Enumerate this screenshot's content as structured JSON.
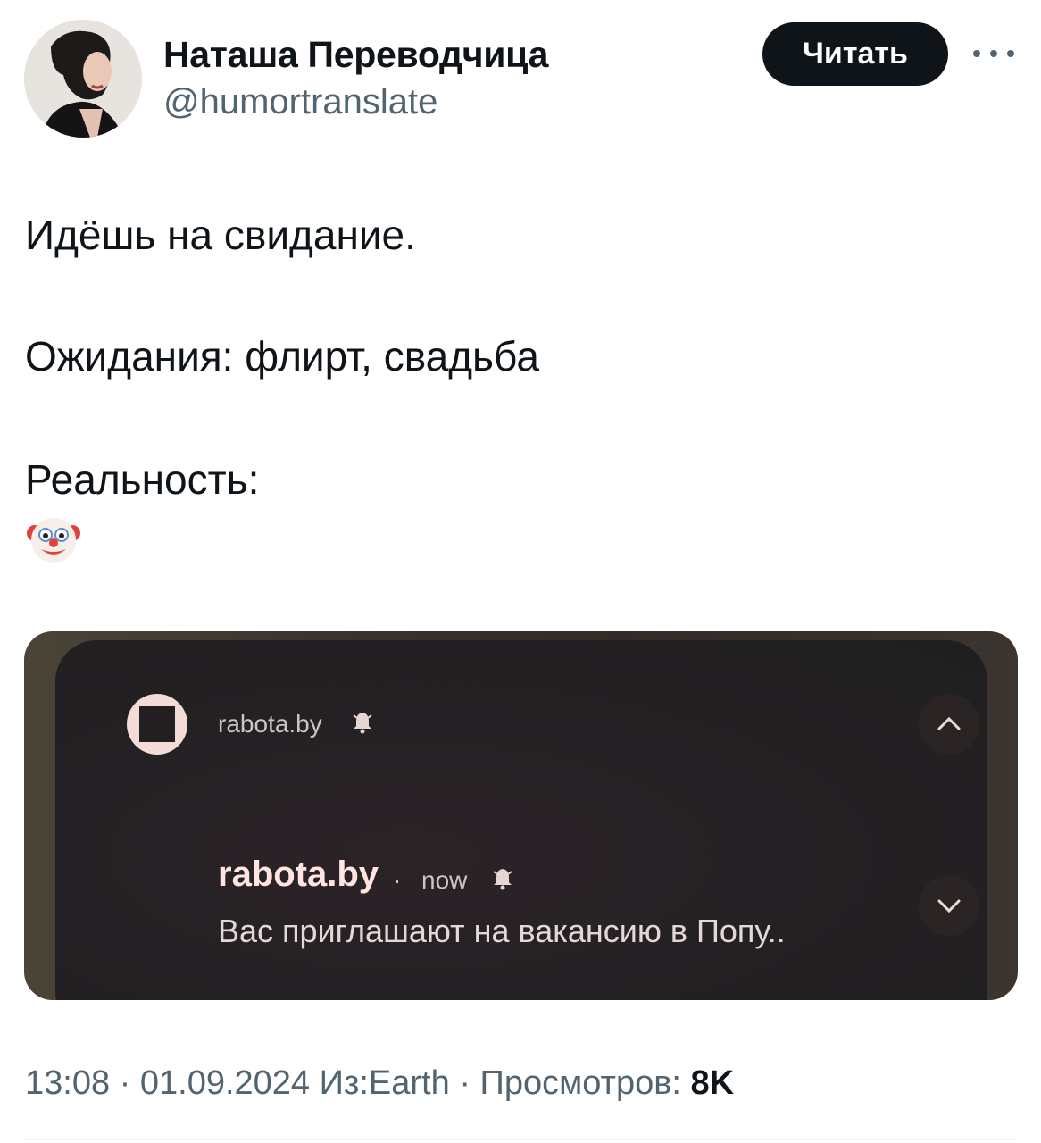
{
  "author": {
    "name": "Наташа Переводчица",
    "handle": "@humortranslate"
  },
  "actions": {
    "follow_label": "Читать"
  },
  "tweet": {
    "lines": [
      "Идёшь на свидание.",
      "Ожидания: флирт, свадьба",
      "Реальность:"
    ],
    "emoji": "clown-face-icon"
  },
  "media": {
    "app_label": "rabota.by",
    "notification": {
      "title": "rabota.by",
      "separator": "·",
      "time": "now",
      "body": "Вас приглашают на вакансию в Попу.."
    }
  },
  "meta": {
    "time": "13:08",
    "sep1": "·",
    "date": "01.09.2024",
    "source": "Из:Earth",
    "sep2": "·",
    "views_label": "Просмотров:",
    "views_count": "8K"
  },
  "colors": {
    "text": "#0f1419",
    "secondary": "#536471",
    "button_bg": "#0f1419"
  }
}
